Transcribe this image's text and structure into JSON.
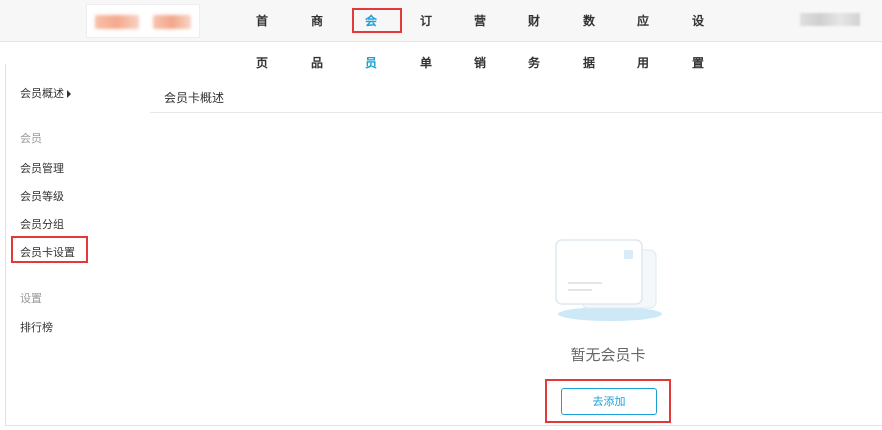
{
  "nav": {
    "items": [
      {
        "label": "首页"
      },
      {
        "label": "商品"
      },
      {
        "label": "会员",
        "active": true
      },
      {
        "label": "订单"
      },
      {
        "label": "营销"
      },
      {
        "label": "财务"
      },
      {
        "label": "数据"
      },
      {
        "label": "应用"
      },
      {
        "label": "设置"
      }
    ]
  },
  "sidebar": {
    "overview": "会员概述",
    "group_member": "会员",
    "items": [
      {
        "label": "会员管理"
      },
      {
        "label": "会员等级"
      },
      {
        "label": "会员分组"
      },
      {
        "label": "会员卡设置",
        "selected": true
      }
    ],
    "group_settings": "设置",
    "rank": "排行榜"
  },
  "main": {
    "title": "会员卡概述",
    "empty_text": "暂无会员卡",
    "add_button": "去添加"
  },
  "colors": {
    "accent": "#1aa0d8",
    "highlight_box": "#e23a3a"
  }
}
